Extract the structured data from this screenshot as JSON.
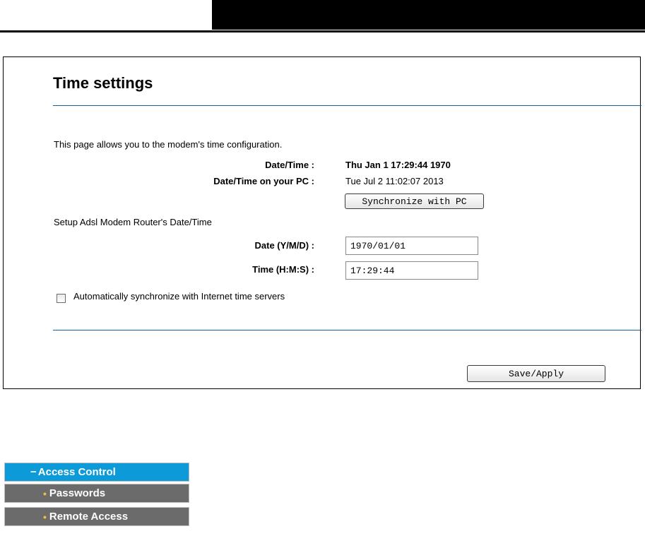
{
  "colors": {
    "accent": "#0d9ad8",
    "divider": "#1a5f9a",
    "menu_gray": "#6b6b6b",
    "bullet": "#f2c230"
  },
  "page": {
    "title": "Time settings",
    "description": "This page allows you to the modem's time configuration."
  },
  "info": {
    "datetime_label": "Date/Time :",
    "datetime_value": "Thu Jan 1 17:29:44 1970",
    "pc_label": "Date/Time on your PC :",
    "pc_value": "Tue Jul 2 11:02:07 2013",
    "sync_button": "Synchronize with PC"
  },
  "setup": {
    "heading": "Setup Adsl Modem Router's Date/Time",
    "date_label": "Date (Y/M/D) :",
    "date_value": "1970/01/01",
    "time_label": "Time (H:M:S) :",
    "time_value": "17:29:44",
    "auto_sync_label": "Automatically synchronize with Internet time servers",
    "auto_sync_checked": false
  },
  "actions": {
    "save_apply": "Save/Apply"
  },
  "menu": {
    "section": "Access Control",
    "section_icon": "minus-icon",
    "items": [
      {
        "label": "Passwords",
        "icon": "bullet-icon"
      },
      {
        "label": "Remote Access",
        "icon": "bullet-icon"
      }
    ]
  }
}
